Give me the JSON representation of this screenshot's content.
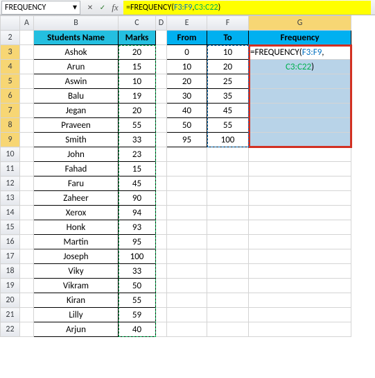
{
  "nameBox": "FREQUENCY",
  "formulaBar": {
    "prefix": "=FREQUENCY(",
    "r1": "F3:F9",
    "comma": ",",
    "r2": "C3:C22",
    "suffix": ")"
  },
  "cols": [
    "A",
    "B",
    "C",
    "D",
    "E",
    "F",
    "G"
  ],
  "rows": [
    "2",
    "3",
    "4",
    "5",
    "6",
    "7",
    "8",
    "9",
    "10",
    "11",
    "12",
    "13",
    "14",
    "15",
    "16",
    "17",
    "18",
    "19",
    "20",
    "21",
    "22"
  ],
  "headers": {
    "b": "Students Name",
    "c": "Marks",
    "e": "From",
    "f": "To",
    "g": "Frequency"
  },
  "students": [
    {
      "name": "Ashok",
      "marks": "20"
    },
    {
      "name": "Arun",
      "marks": "15"
    },
    {
      "name": "Aswin",
      "marks": "10"
    },
    {
      "name": "Balu",
      "marks": "19"
    },
    {
      "name": "Jegan",
      "marks": "20"
    },
    {
      "name": "Praveen",
      "marks": "55"
    },
    {
      "name": "Smith",
      "marks": "33"
    },
    {
      "name": "John",
      "marks": "23"
    },
    {
      "name": "Fahad",
      "marks": "15"
    },
    {
      "name": "Faru",
      "marks": "45"
    },
    {
      "name": "Zaheer",
      "marks": "90"
    },
    {
      "name": "Xerox",
      "marks": "94"
    },
    {
      "name": "Honk",
      "marks": "93"
    },
    {
      "name": "Martin",
      "marks": "95"
    },
    {
      "name": "Joseph",
      "marks": "100"
    },
    {
      "name": "Viky",
      "marks": "33"
    },
    {
      "name": "Vikram",
      "marks": "50"
    },
    {
      "name": "Kiran",
      "marks": "55"
    },
    {
      "name": "Lilly",
      "marks": "59"
    },
    {
      "name": "Arjun",
      "marks": "40"
    }
  ],
  "bins": [
    {
      "from": "0",
      "to": "10"
    },
    {
      "from": "10",
      "to": "20"
    },
    {
      "from": "20",
      "to": "25"
    },
    {
      "from": "30",
      "to": "35"
    },
    {
      "from": "40",
      "to": "45"
    },
    {
      "from": "50",
      "to": "55"
    },
    {
      "from": "95",
      "to": "100"
    }
  ],
  "cellFormula": {
    "prefix": "=FREQUENCY(",
    "r1": "F3:F9",
    "comma": ",",
    "line2a": "C3:C22",
    "line2b": ")"
  }
}
